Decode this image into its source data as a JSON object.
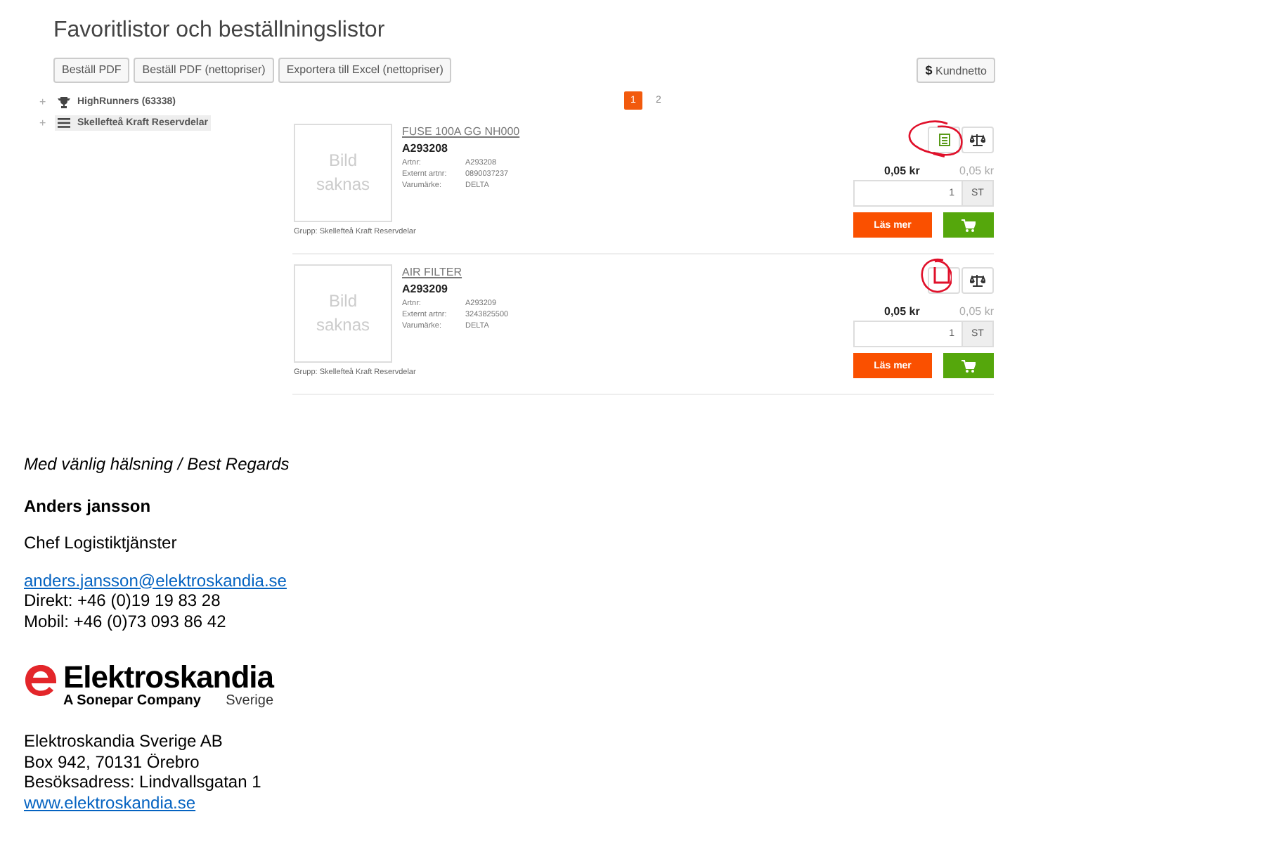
{
  "page": {
    "title": "Favoritlistor och beställningslistor",
    "actions": [
      "Beställ PDF",
      "Beställ PDF (nettopriser)",
      "Exportera till Excel (nettopriser)"
    ],
    "price_toggle": {
      "symbol": "$",
      "label": "Kundnetto"
    },
    "tree": [
      {
        "toggle": "+",
        "kind": "trophy",
        "label": "HighRunners (63338)",
        "selected": false
      },
      {
        "toggle": "+",
        "kind": "list",
        "label": "Skellefteå Kraft Reservdelar",
        "selected": true
      }
    ],
    "pages": [
      {
        "label": "1",
        "selected": true
      },
      {
        "label": "2",
        "selected": false
      }
    ],
    "products": [
      {
        "image_placeholder": "Bild saknas",
        "name": "FUSE 100A GG NH000",
        "number": "A293208",
        "details": [
          {
            "label": "Artnr:",
            "value": "A293208"
          },
          {
            "label": "Externt artnr:",
            "value": "0890037237"
          },
          {
            "label": "Varumärke:",
            "value": "DELTA"
          }
        ],
        "group": "Grupp: Skellefteå Kraft Reservdelar",
        "in_list": true,
        "annotated": true,
        "price": "0,05 kr",
        "list_price": "0,05 kr",
        "quantity": "1",
        "unit": "ST",
        "read_more": "Läs mer"
      },
      {
        "image_placeholder": "Bild saknas",
        "name": "AIR FILTER",
        "number": "A293209",
        "details": [
          {
            "label": "Artnr:",
            "value": "A293209"
          },
          {
            "label": "Externt artnr:",
            "value": "3243825500"
          },
          {
            "label": "Varumärke:",
            "value": "DELTA"
          }
        ],
        "group": "Grupp: Skellefteå Kraft Reservdelar",
        "in_list": false,
        "annotated": true,
        "price": "0,05 kr",
        "list_price": "0,05 kr",
        "quantity": "1",
        "unit": "ST",
        "read_more": "Läs mer"
      }
    ]
  },
  "signature": {
    "greeting": "Med vänlig hälsning / Best Regards",
    "name": "Anders jansson",
    "role": "Chef Logistiktjänster",
    "email": "anders.jansson@elektroskandia.se",
    "phone_lines": [
      "Direkt: +46 (0)19 19 83 28",
      "Mobil: +46 (0)73 093 86 42"
    ],
    "logo": {
      "brand": "Elektroskandia",
      "tagline": "A Sonepar Company",
      "region": "Sverige"
    },
    "address_lines": [
      "Elektroskandia Sverige AB",
      "Box 942, 70131 Örebro",
      "Besöksadress: Lindvallsgatan 1"
    ],
    "website": "www.elektroskandia.se"
  }
}
